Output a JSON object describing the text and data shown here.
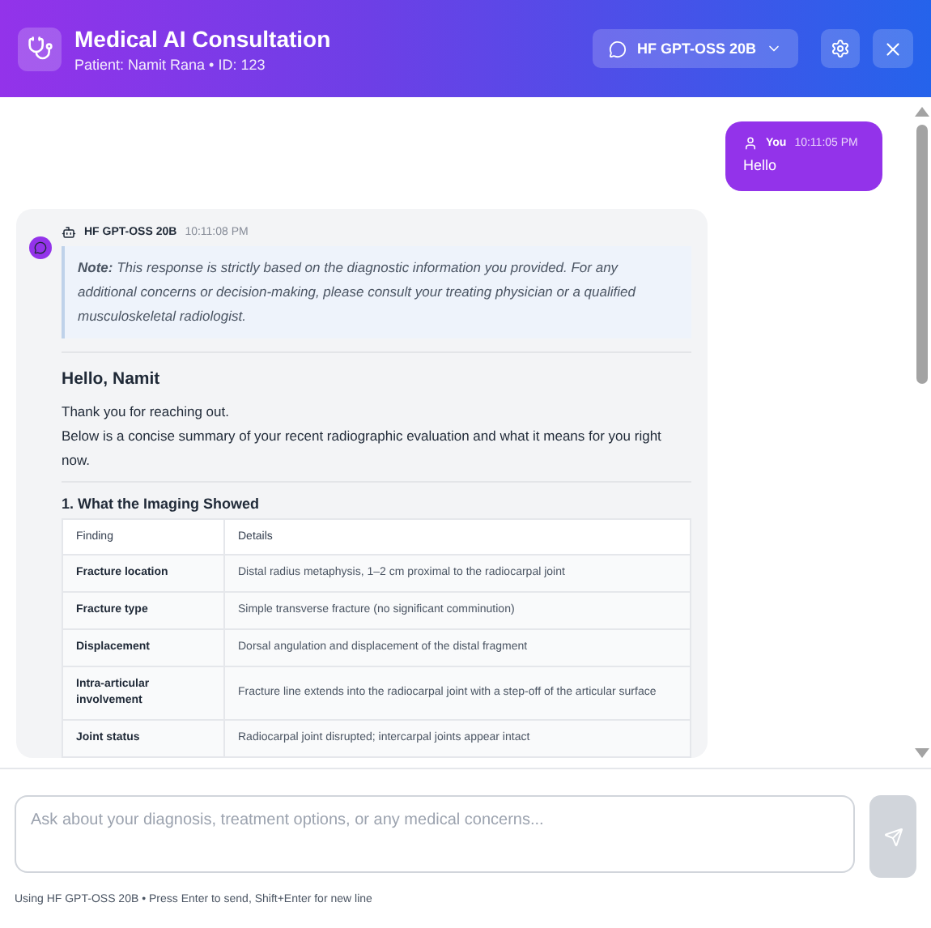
{
  "header": {
    "title": "Medical AI Consultation",
    "subtitle": "Patient: Namit Rana • ID: 123",
    "model_button": "HF GPT-OSS 20B"
  },
  "messages": [
    {
      "kind": "user",
      "author": "You",
      "time": "10:11:05 PM",
      "text": "Hello"
    },
    {
      "kind": "assistant",
      "author": "HF GPT-OSS 20B",
      "time": "10:11:08 PM",
      "note": "**Note:** This response is strictly based on the diagnostic information you provided. For any additional concerns or decision-making, please consult your treating physician or a qualified musculoskeletal radiologist.",
      "greeting": "Hello, Namit",
      "paragraphs": [
        "Thank you for reaching out.",
        "Below is a concise summary of your recent radiographic evaluation and what it means for you right now."
      ],
      "section": "1. What the Imaging Showed",
      "table": {
        "columns": [
          "Finding",
          "Details"
        ],
        "rows": [
          [
            "Fracture location",
            "Distal radius metaphysis, 1–2 cm proximal to the radiocarpal joint"
          ],
          [
            "Fracture type",
            "Simple transverse fracture (no significant comminution)"
          ],
          [
            "Displacement",
            "Dorsal angulation and displacement of the distal fragment"
          ],
          [
            "Intra-articular involvement",
            "Fracture line extends into the radiocarpal joint with a step-off of the articular surface"
          ],
          [
            "Joint status",
            "Radiocarpal joint disrupted; intercarpal joints appear intact"
          ]
        ]
      }
    }
  ],
  "composer": {
    "placeholder": "Ask about your diagnosis, treatment options, or any medical concerns...",
    "send_disabled": true,
    "hint": "Using HF GPT-OSS 20B • Press Enter to send, Shift+Enter for new line"
  }
}
